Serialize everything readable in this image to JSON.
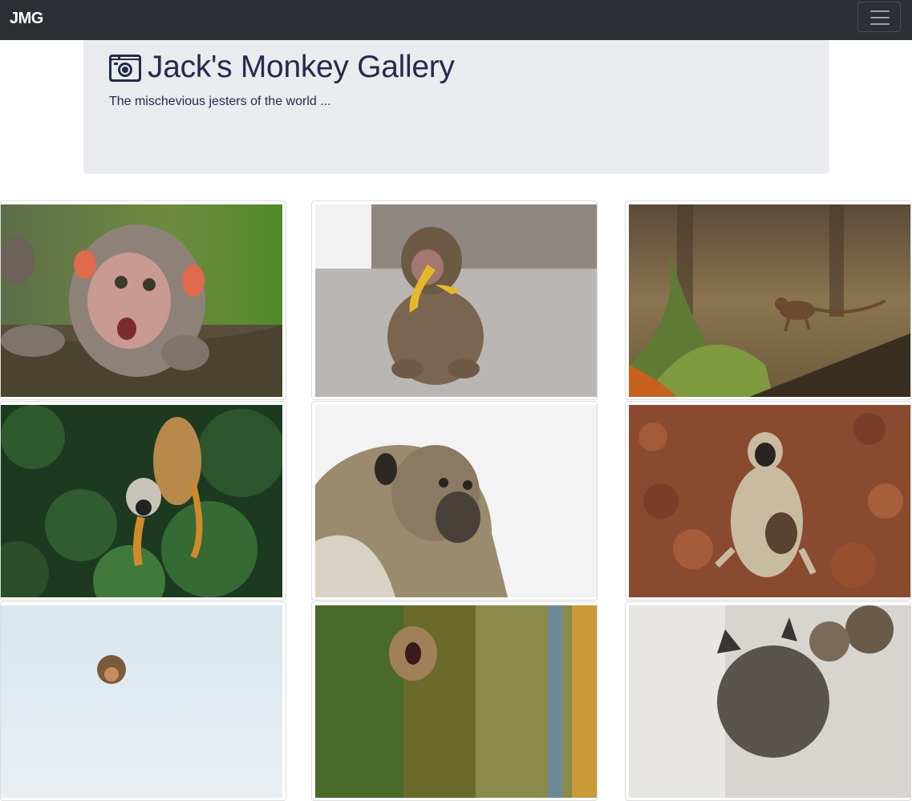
{
  "navbar": {
    "brand": "JMG",
    "toggle_icon": "hamburger-menu-icon",
    "background": "#2c3035"
  },
  "jumbotron": {
    "icon": "camera-icon",
    "title": "Jack's Monkey Gallery",
    "subtitle": "The mischevious jesters of the world ...",
    "background": "#e9ebee",
    "text_color": "#252b4d"
  },
  "gallery": {
    "photos": [
      {
        "subject": "baby macaque on branch"
      },
      {
        "subject": "macaque eating banana"
      },
      {
        "subject": "small monkey on log in grass"
      },
      {
        "subject": "squirrel monkey in foliage"
      },
      {
        "subject": "long-tailed macaque portrait"
      },
      {
        "subject": "langur with baby on leaves"
      },
      {
        "subject": "monkey in sky"
      },
      {
        "subject": "monkey yelling"
      },
      {
        "subject": "monkey close-up"
      }
    ]
  }
}
